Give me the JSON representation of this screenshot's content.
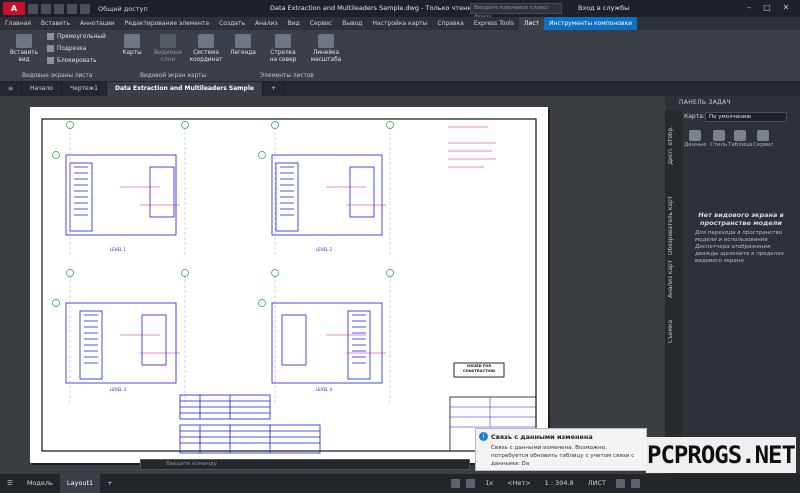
{
  "titlebar": {
    "app_logo": "A",
    "share": "Общий доступ",
    "title": "Data Extraction and Multileaders Sample.dwg - Только чтение",
    "search_placeholder": "Введите ключевое слово/фразу",
    "login": "Вход в службы"
  },
  "ribbon_tabs": [
    "Главная",
    "Вставить",
    "Аннотации",
    "Редактирование элемента",
    "Создать",
    "Анализ",
    "Вид",
    "Сервис",
    "Вывод",
    "Настройка карты",
    "Справка",
    "Express Tools",
    "Лист",
    "Инструменты компоновки"
  ],
  "ribbon": {
    "insert_view": "Вставить вид",
    "rect": "Прямоугольный",
    "fit": "Подрезка",
    "lock": "Блокировать",
    "maps": "Карты",
    "visible_layers": "Видимые слои",
    "coord_system": "Система координат",
    "legend": "Легенда",
    "north_arrow": "Стрелка на север",
    "scale_bar": "Линейка масштаба",
    "panel1": "Видовые экраны листа",
    "panel2": "Видовой экран карты",
    "panel3": "Элементы листов"
  },
  "file_tabs": {
    "menu": "≡",
    "start": "Начало",
    "draft": "Чертеж1",
    "active": "Data Extraction and Multileaders Sample",
    "add": "+"
  },
  "drawing": {
    "level1": "LEVEL 1",
    "level2": "LEVEL 2",
    "level3": "LEVEL 3",
    "level4": "LEVEL 4",
    "stamp": "ISSUED FOR CONSTRUCTION",
    "cmd_placeholder": "Введите команду"
  },
  "task_pane": {
    "header": "ПАНЕЛЬ ЗАДАЧ",
    "map_label": "Карта:",
    "map_value": "По умолчанию",
    "tools": [
      "Данные",
      "Стиль",
      "Таблица",
      "Сервис"
    ],
    "vtabs": [
      "Дисп. отобр.",
      "Обозреватель карт",
      "Анализ карт",
      "Съемка"
    ],
    "message": "Нет видового экрана в пространстве модели",
    "description": "Для перехода в пространство модели и использования Диспетчера отображения дважды щелкните в пределах видового экрана"
  },
  "statusbar": {
    "model": "Модель",
    "layout": "Layout1",
    "add": "+",
    "scale_multiplier": "1x",
    "style": "<Нет>",
    "scale": "1 : 304.8",
    "space": "ЛИСТ"
  },
  "notification": {
    "title": "Связь с данными изменена",
    "body": "Связь с данными изменена.  Возможно, потребуется обновить таблицу с учетом связи с данными: Da"
  },
  "watermark": "PCPROGS.NET",
  "colors": {
    "accent": "#0f6fc0",
    "logo": "#c8102e",
    "sheet": "#ffffff",
    "drawing_lines": "#1c1cd9",
    "annotations": "#e0168f",
    "grid_bubbles": "#21a33a"
  }
}
